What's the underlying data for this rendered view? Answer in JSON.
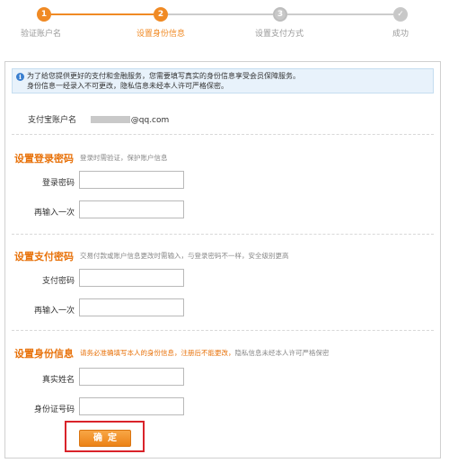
{
  "steps": [
    {
      "number": "1",
      "label": "验证账户名",
      "state": "done"
    },
    {
      "number": "2",
      "label": "设置身份信息",
      "state": "active"
    },
    {
      "number": "3",
      "label": "设置支付方式",
      "state": "pending"
    },
    {
      "number": "✓",
      "label": "成功",
      "state": "pending"
    }
  ],
  "notice": {
    "line1": "为了给您提供更好的支付和金融服务，您需要填写真实的身份信息享受会员保障服务。",
    "line2": "身份信息一经录入不可更改，隐私信息未经本人许可严格保密。"
  },
  "account": {
    "label": "支付宝账户名",
    "value_suffix": "@qq.com"
  },
  "login_section": {
    "title": "设置登录密码",
    "hint": "登录时需验证，保护账户信息",
    "password_label": "登录密码",
    "confirm_label": "再输入一次",
    "password_value": "",
    "confirm_value": ""
  },
  "pay_section": {
    "title": "设置支付密码",
    "hint": "交易付款或账户信息更改时需输入，与登录密码不一样，安全级别更高",
    "password_label": "支付密码",
    "confirm_label": "再输入一次",
    "password_value": "",
    "confirm_value": ""
  },
  "identity_section": {
    "title": "设置身份信息",
    "hint_warn": "请务必准确填写本人的身份信息，注册后不能更改，",
    "hint_plain": "隐私信息未经本人许可严格保密",
    "name_label": "真实姓名",
    "id_label": "身份证号码",
    "name_value": "",
    "id_value": ""
  },
  "confirm_button": "确定",
  "colors": {
    "accent": "#f08a24",
    "pending": "#cccccc",
    "highlight": "#d9232a",
    "notice_bg": "#e8f2fb"
  },
  "icons": {
    "notice": "info-icon",
    "final_step": "check-icon"
  }
}
